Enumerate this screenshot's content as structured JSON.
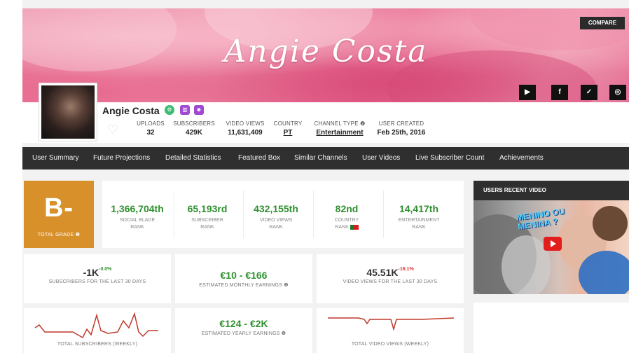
{
  "banner": {
    "title": "Angie Costa",
    "compare_label": "COMPARE",
    "social_icons": [
      "youtube-icon",
      "facebook-icon",
      "twitter-icon",
      "instagram-icon"
    ],
    "social_glyphs": [
      "▶",
      "f",
      "✓",
      "◎"
    ]
  },
  "channel": {
    "name": "Angie Costa",
    "badges": [
      {
        "icon": "settings-badge-icon",
        "glyph": "⚙",
        "color": "#3dbb73"
      },
      {
        "icon": "chart-badge-icon",
        "glyph": "▥",
        "color": "#a04ad2"
      },
      {
        "icon": "users-badge-icon",
        "glyph": "☻",
        "color": "#a04ad2"
      }
    ],
    "stats": [
      {
        "label": "UPLOADS",
        "value": "32"
      },
      {
        "label": "SUBSCRIBERS",
        "value": "429K"
      },
      {
        "label": "VIDEO VIEWS",
        "value": "11,631,409"
      },
      {
        "label": "COUNTRY",
        "value": "PT"
      },
      {
        "label": "CHANNEL TYPE ❷",
        "value": "Entertainment"
      },
      {
        "label": "USER CREATED",
        "value": "Feb 25th, 2016"
      }
    ]
  },
  "nav": {
    "items": [
      "User Summary",
      "Future Projections",
      "Detailed Statistics",
      "Featured Box",
      "Similar Channels",
      "User Videos",
      "Live Subscriber Count",
      "Achievements"
    ]
  },
  "grade": {
    "value": "B-",
    "label": "TOTAL GRADE ❷"
  },
  "ranks": [
    {
      "value": "1,366,704th",
      "label1": "SOCIAL BLADE",
      "label2": "RANK"
    },
    {
      "value": "65,193rd",
      "label1": "SUBSCRIBER",
      "label2": "RANK"
    },
    {
      "value": "432,155th",
      "label1": "VIDEO VIEWS",
      "label2": "RANK"
    },
    {
      "value": "82nd",
      "label1": "COUNTRY",
      "label2": "RANK"
    },
    {
      "value": "14,417th",
      "label1": "ENTERTAINMENT",
      "label2": "RANK"
    }
  ],
  "metrics": {
    "subs_value": "-1K",
    "subs_pct": "-0.0%",
    "subs_label": "SUBSCRIBERS FOR THE LAST 30 DAYS",
    "monthly_value": "€10 - €166",
    "monthly_label": "ESTIMATED MONTHLY EARNINGS ❷",
    "views_value": "45.51K",
    "views_pct": "-16.1%",
    "views_label": "VIDEO VIEWS FOR THE LAST 30 DAYS",
    "yearly_value": "€124 - €2K",
    "yearly_label": "ESTIMATED YEARLY EARNINGS ❷",
    "weekly_subs_label": "TOTAL SUBSCRIBERS (WEEKLY)",
    "weekly_views_label": "TOTAL VIDEO VIEWS (WEEKLY)"
  },
  "recent_video": {
    "header": "USERS RECENT VIDEO",
    "thumb_line1": "MENINO OU",
    "thumb_line2": "MENINA ?"
  },
  "colors": {
    "accent_green": "#2f8f2f",
    "grade_orange": "#d8912a",
    "nav_dark": "#2f2f2f",
    "sparkline_red": "#c0392b"
  }
}
